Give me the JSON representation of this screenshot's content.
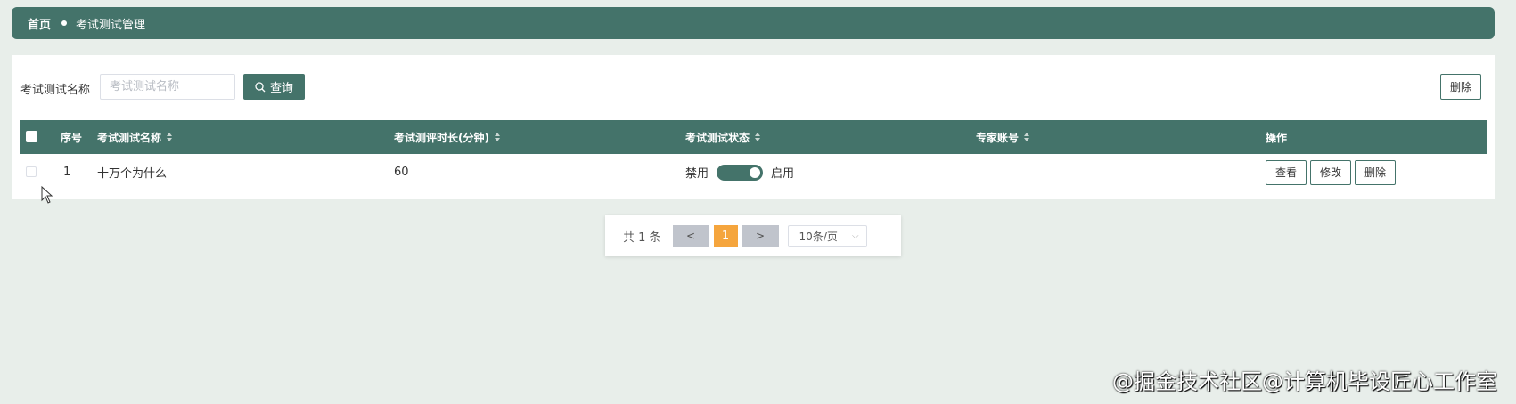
{
  "breadcrumb": {
    "home": "首页",
    "current": "考试测试管理"
  },
  "search": {
    "label": "考试测试名称",
    "placeholder": "考试测试名称",
    "value": "",
    "button_label": "查询",
    "delete_label": "删除"
  },
  "table": {
    "headers": [
      "序号",
      "考试测试名称",
      "考试测评时长(分钟)",
      "考试测试状态",
      "专家账号",
      "操作"
    ],
    "rows": [
      {
        "index": "1",
        "name": "十万个为什么",
        "duration": "60",
        "status_off": "禁用",
        "status_on": "启用",
        "expert": "",
        "actions": [
          "查看",
          "修改",
          "删除"
        ]
      }
    ]
  },
  "pagination": {
    "total": "共 1 条",
    "prev": "<",
    "page": "1",
    "next": ">",
    "size": "10条/页"
  },
  "watermark": "@掘金技术社区@计算机毕设匠心工作室",
  "colors": {
    "primary": "#44736a",
    "accent": "#f5a53d",
    "background": "#e8eeea"
  }
}
